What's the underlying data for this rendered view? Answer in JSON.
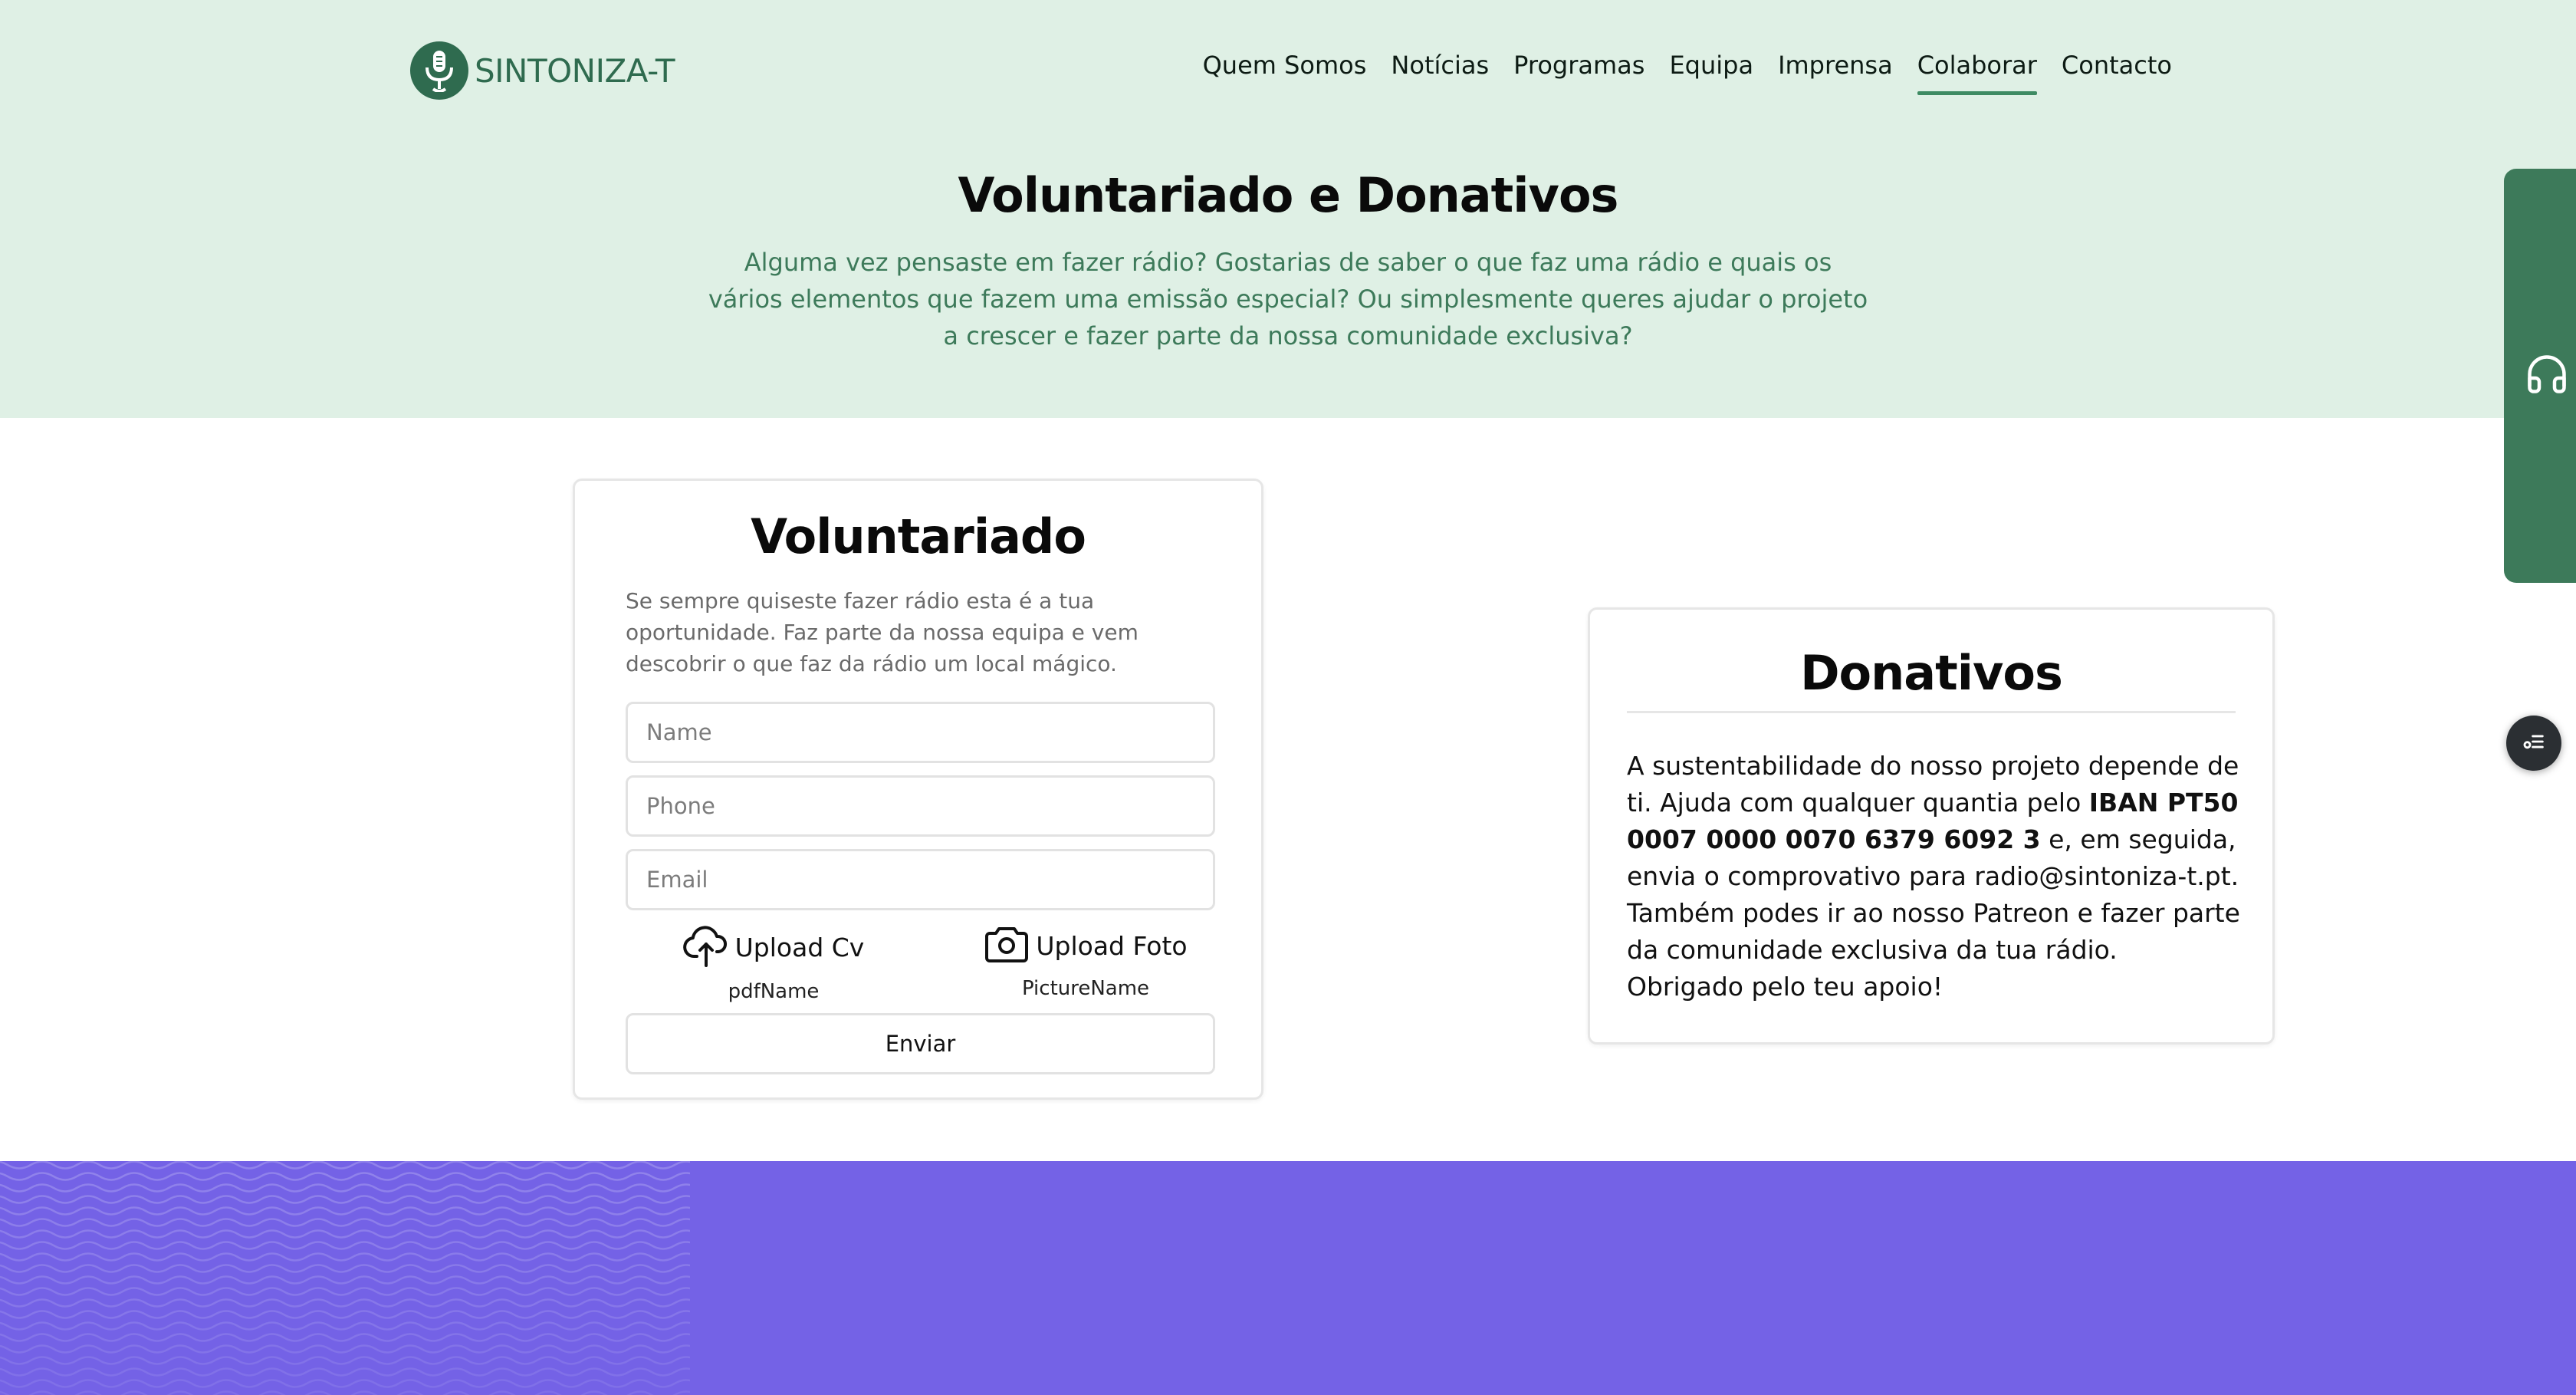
{
  "brand": {
    "name": "SINTONIZA-T"
  },
  "nav": {
    "items": [
      {
        "label": "Quem Somos",
        "active": false
      },
      {
        "label": "Notícias",
        "active": false
      },
      {
        "label": "Programas",
        "active": false
      },
      {
        "label": "Equipa",
        "active": false
      },
      {
        "label": "Imprensa",
        "active": false
      },
      {
        "label": "Colaborar",
        "active": true
      },
      {
        "label": "Contacto",
        "active": false
      }
    ]
  },
  "hero": {
    "title": "Voluntariado e Donativos",
    "subtitle": "Alguma vez pensaste em fazer rádio? Gostarias de saber o que faz uma rádio e quais os vários elementos que fazem uma emissão especial? Ou simplesmente queres ajudar o projeto a crescer e fazer parte da nossa comunidade exclusiva?"
  },
  "volunteer": {
    "title": "Voluntariado",
    "description": "Se sempre quiseste fazer rádio esta é a tua oportunidade. Faz parte da nossa equipa e vem descobrir o que faz da rádio um local mágico.",
    "fields": {
      "name_placeholder": "Name",
      "phone_placeholder": "Phone",
      "email_placeholder": "Email"
    },
    "upload_cv": {
      "label": "Upload Cv",
      "filename": "pdfName",
      "icon": "cloud-upload-icon"
    },
    "upload_photo": {
      "label": "Upload Foto",
      "filename": "PictureName",
      "icon": "camera-icon"
    },
    "submit_label": "Enviar"
  },
  "donations": {
    "title": "Donativos",
    "text_before_iban": "A sustentabilidade do nosso projeto depende de ti. Ajuda com qualquer quantia pelo ",
    "iban": "IBAN PT50 0007 0000 0070 6379 6092 3",
    "text_after_iban": " e, em seguida, envia o comprovativo para radio@sintoniza-t.pt.",
    "patreon_text": "Também podes ir ao nosso Patreon e fazer parte da comunidade exclusiva da tua rádio.",
    "thanks": "Obrigado pelo teu apoio!"
  },
  "side_tab": {
    "icon": "headphones-icon"
  },
  "floating_button": {
    "icon": "filter-list-icon"
  },
  "colors": {
    "hero_bg": "#dff0e5",
    "brand_green": "#2f6b4f",
    "accent_green": "#3e8b63",
    "subtitle_green": "#3d7a5a",
    "footer_purple": "#7462e6"
  }
}
